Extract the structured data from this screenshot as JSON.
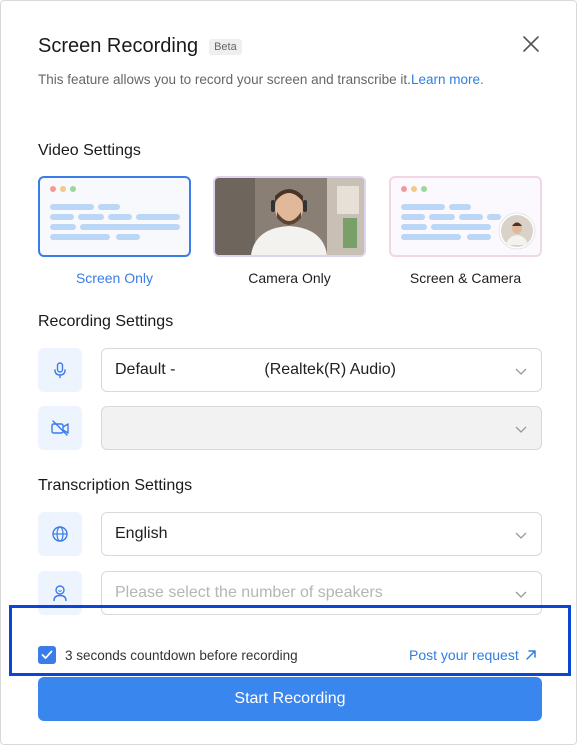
{
  "dialog": {
    "title": "Screen Recording",
    "badge": "Beta",
    "description": "This feature allows you to record your screen and transcribe it.",
    "learn_more": "Learn more."
  },
  "video_settings": {
    "heading": "Video Settings",
    "options": [
      {
        "label": "Screen Only",
        "selected": true
      },
      {
        "label": "Camera Only",
        "selected": false
      },
      {
        "label": "Screen & Camera",
        "selected": false
      }
    ]
  },
  "recording_settings": {
    "heading": "Recording Settings",
    "microphone": {
      "value": "Default -                    (Realtek(R) Audio)",
      "icon": "microphone-icon"
    },
    "camera": {
      "value": "",
      "icon": "camera-off-icon"
    }
  },
  "transcription_settings": {
    "heading": "Transcription Settings",
    "language": {
      "value": "English",
      "icon": "globe-icon"
    },
    "speakers": {
      "placeholder": "Please select the number of speakers",
      "icon": "person-icon"
    }
  },
  "footer": {
    "countdown_label": "3 seconds countdown before recording",
    "countdown_checked": true,
    "post_request": "Post your request",
    "start_button": "Start Recording"
  },
  "colors": {
    "accent": "#3a7ce8",
    "button": "#3a86ef",
    "highlight": "#0a46d6"
  }
}
